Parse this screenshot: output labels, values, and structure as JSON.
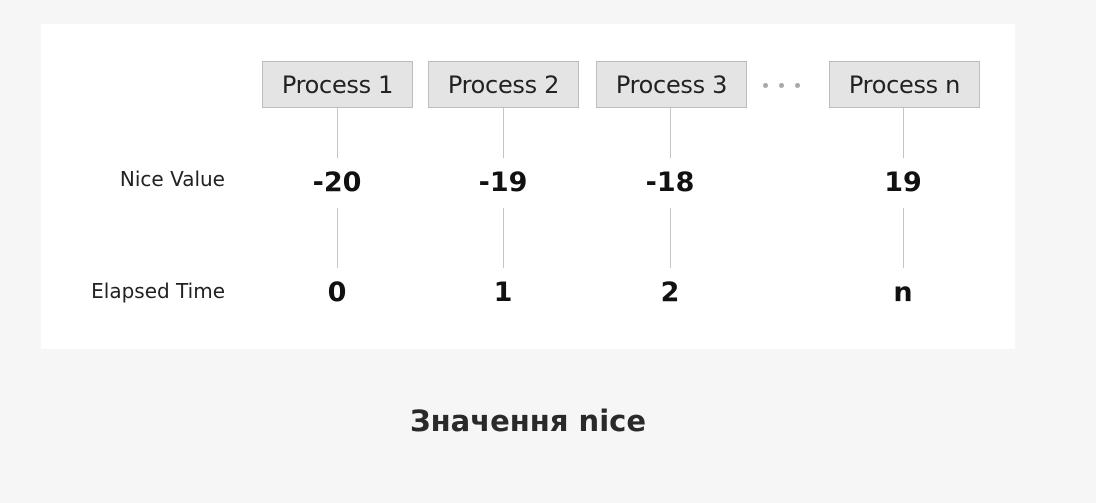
{
  "diagram": {
    "processes": [
      "Process 1",
      "Process 2",
      "Process 3",
      "Process n"
    ],
    "row_labels": {
      "nice_value": "Nice Value",
      "elapsed_time": "Elapsed Time"
    },
    "nice_values": [
      "-20",
      "-19",
      "-18",
      "19"
    ],
    "elapsed_times": [
      "0",
      "1",
      "2",
      "n"
    ]
  },
  "caption": "Значення nice"
}
